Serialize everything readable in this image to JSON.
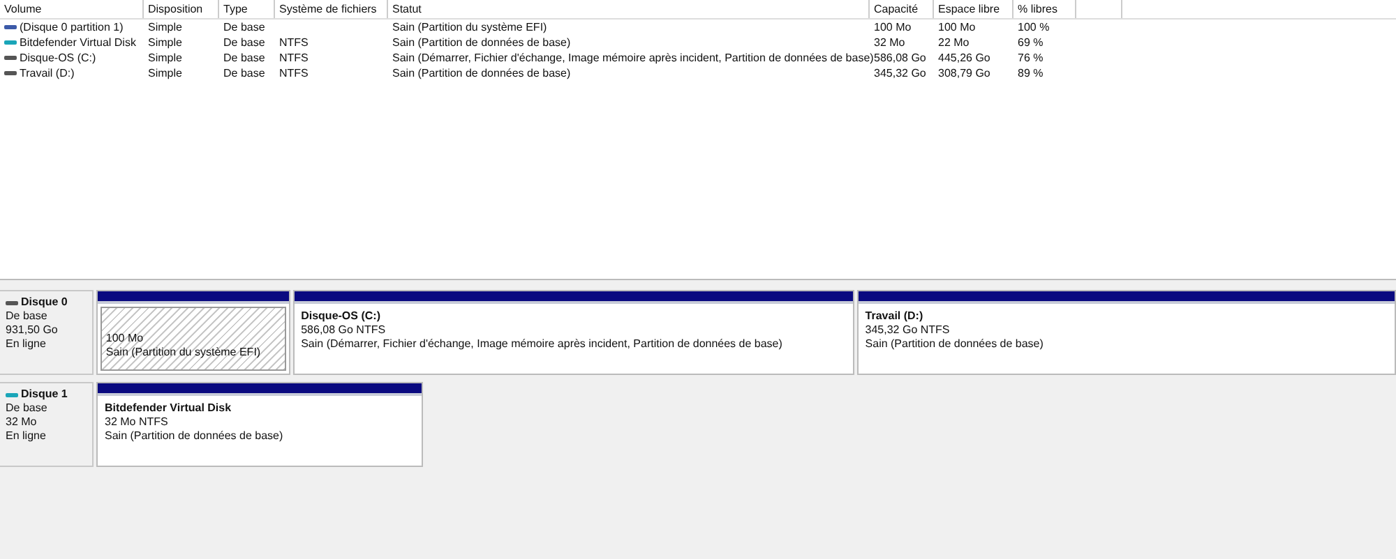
{
  "volumes_table": {
    "columns": [
      "Volume",
      "Disposition",
      "Type",
      "Système de fichiers",
      "Statut",
      "Capacité",
      "Espace libre",
      "% libres"
    ],
    "rows": [
      {
        "color": "#3c5aa8",
        "cells": [
          "(Disque 0 partition 1)",
          "Simple",
          "De base",
          "",
          "Sain (Partition du système EFI)",
          "100 Mo",
          "100 Mo",
          "100 %"
        ]
      },
      {
        "color": "#1aa5b8",
        "cells": [
          "Bitdefender Virtual Disk",
          "Simple",
          "De base",
          "NTFS",
          "Sain (Partition de données de base)",
          "32 Mo",
          "22 Mo",
          "69 %"
        ]
      },
      {
        "color": "#555555",
        "cells": [
          "Disque-OS (C:)",
          "Simple",
          "De base",
          "NTFS",
          "Sain (Démarrer, Fichier d'échange, Image mémoire après incident, Partition de données de base)",
          "586,08 Go",
          "445,26 Go",
          "76 %"
        ]
      },
      {
        "color": "#555555",
        "cells": [
          "Travail (D:)",
          "Simple",
          "De base",
          "NTFS",
          "Sain (Partition de données de base)",
          "345,32 Go",
          "308,79 Go",
          "89 %"
        ]
      }
    ]
  },
  "disks": [
    {
      "name": "Disque 0",
      "color": "#555555",
      "info": [
        "De base",
        "931,50 Go",
        "En ligne"
      ],
      "partitions": [
        {
          "kind": "hatched",
          "lines": [
            "100 Mo",
            "Sain (Partition du système EFI)"
          ]
        },
        {
          "kind": "volume",
          "title": "Disque-OS  (C:)",
          "lines": [
            "586,08 Go NTFS",
            "Sain (Démarrer, Fichier d'échange, Image mémoire après incident, Partition de données de base)"
          ]
        },
        {
          "kind": "volume",
          "title": "Travail  (D:)",
          "lines": [
            "345,32 Go NTFS",
            "Sain (Partition de données de base)"
          ]
        }
      ]
    },
    {
      "name": "Disque 1",
      "color": "#1aa5b8",
      "info": [
        "De base",
        "32 Mo",
        "En ligne"
      ],
      "partitions": [
        {
          "kind": "volume",
          "title": "Bitdefender Virtual Disk",
          "lines": [
            "32 Mo NTFS",
            "Sain (Partition de données de base)"
          ]
        }
      ]
    }
  ]
}
